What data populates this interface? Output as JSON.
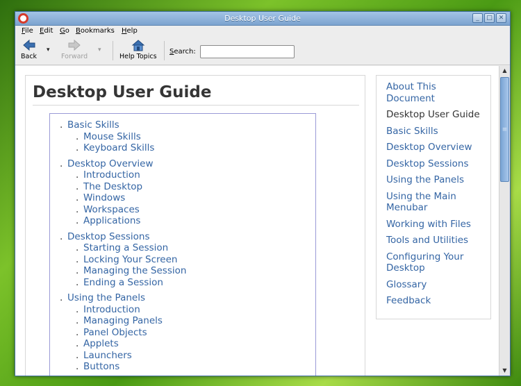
{
  "window": {
    "title": "Desktop User Guide"
  },
  "menu": [
    "File",
    "Edit",
    "Go",
    "Bookmarks",
    "Help"
  ],
  "toolbar": {
    "back_label": "Back",
    "forward_label": "Forward",
    "help_topics_label": "Help Topics",
    "search_label": "Search:",
    "search_value": ""
  },
  "document": {
    "title": "Desktop User Guide",
    "toc": [
      {
        "label": "Basic Skills",
        "children": [
          "Mouse Skills",
          "Keyboard Skills"
        ]
      },
      {
        "label": "Desktop Overview",
        "children": [
          "Introduction",
          "The Desktop",
          "Windows",
          "Workspaces",
          "Applications"
        ]
      },
      {
        "label": "Desktop Sessions",
        "children": [
          "Starting a Session",
          "Locking Your Screen",
          "Managing the Session",
          "Ending a Session"
        ]
      },
      {
        "label": "Using the Panels",
        "children": [
          "Introduction",
          "Managing Panels",
          "Panel Objects",
          "Applets",
          "Launchers",
          "Buttons"
        ]
      }
    ]
  },
  "sidebar": {
    "items": [
      {
        "label": "About This Document",
        "current": false
      },
      {
        "label": "Desktop User Guide",
        "current": true
      },
      {
        "label": "Basic Skills",
        "current": false
      },
      {
        "label": "Desktop Overview",
        "current": false
      },
      {
        "label": "Desktop Sessions",
        "current": false
      },
      {
        "label": "Using the Panels",
        "current": false
      },
      {
        "label": "Using the Main Menubar",
        "current": false
      },
      {
        "label": "Working with Files",
        "current": false
      },
      {
        "label": "Tools and Utilities",
        "current": false
      },
      {
        "label": "Configuring Your Desktop",
        "current": false
      },
      {
        "label": "Glossary",
        "current": false
      },
      {
        "label": "Feedback",
        "current": false
      }
    ]
  },
  "colors": {
    "link": "#3465a4",
    "titlebar": "#7ca3cf"
  },
  "icons": {
    "window": "help-lifebuoy-icon",
    "back": "arrow-left-icon",
    "forward": "arrow-right-icon",
    "help_topics": "home-icon",
    "window_buttons": [
      "minimize-icon",
      "maximize-icon",
      "close-icon"
    ]
  }
}
